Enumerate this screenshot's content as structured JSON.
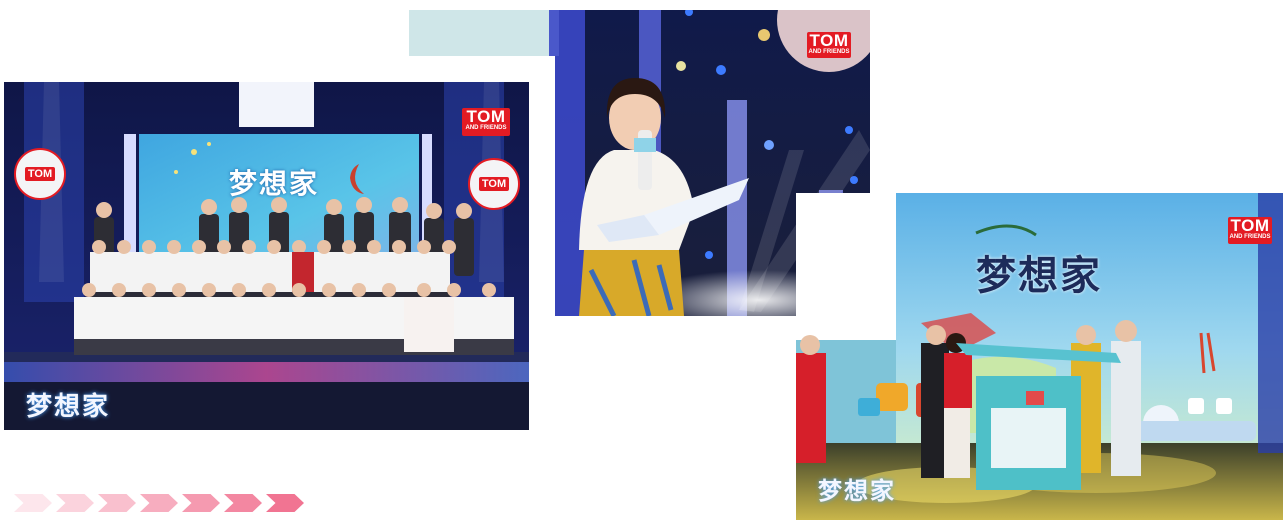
{
  "photos": {
    "group": {
      "logo_main": "TOM",
      "logo_sub": "AND FRIENDS",
      "round_logo": "TOM",
      "screen_title": "梦想家",
      "watermark": "梦想家"
    },
    "host": {
      "logo_main": "TOM",
      "logo_sub": "AND FRIENDS"
    },
    "ceremony": {
      "logo_main": "TOM",
      "logo_sub": "AND FRIENDS",
      "screen_title": "梦想家",
      "watermark": "梦想家"
    }
  },
  "decoration": {
    "chevron_colors": [
      "#fde6ec",
      "#fbd3dd",
      "#f9c0ce",
      "#f7adbf",
      "#f59ab0",
      "#f387a1",
      "#f17492"
    ]
  }
}
